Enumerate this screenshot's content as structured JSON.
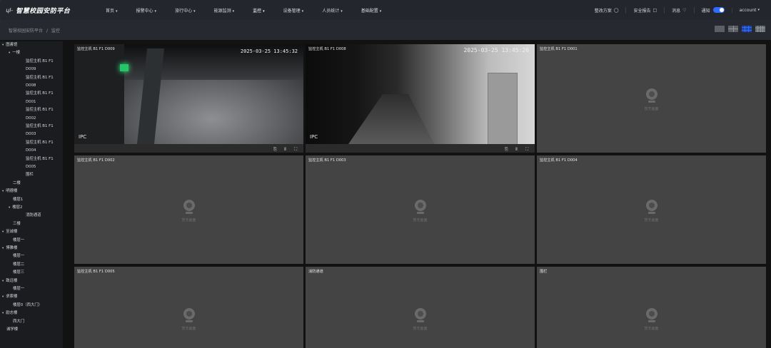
{
  "app": {
    "logo_mark": "ɥl-",
    "title": "智慧校园安防平台"
  },
  "nav": [
    {
      "label": "首页",
      "active": false
    },
    {
      "label": "报警中心",
      "active": false
    },
    {
      "label": "旅行中心",
      "active": false
    },
    {
      "label": "能源监测",
      "active": false
    },
    {
      "label": "监控",
      "active": true
    },
    {
      "label": "设备管理",
      "active": false
    },
    {
      "label": "人员统计",
      "active": false
    },
    {
      "label": "基础配置",
      "active": false
    }
  ],
  "tools": {
    "rectify": "整改方案",
    "security_report": "安全报告",
    "messages": "消息",
    "notify": "通知",
    "account": "account"
  },
  "breadcrumb": [
    "智慧校园安防平台",
    "监控"
  ],
  "tree": [
    {
      "label": "图書馆",
      "level": 0,
      "arrow": "▾"
    },
    {
      "label": "一楼",
      "level": 1,
      "arrow": "▾"
    },
    {
      "label": "监控主机 B1 F1",
      "level": 2
    },
    {
      "label": "D009",
      "level": 2
    },
    {
      "label": "监控主机 B1 F1",
      "level": 2
    },
    {
      "label": "D008",
      "level": 2
    },
    {
      "label": "监控主机 B1 F1",
      "level": 2
    },
    {
      "label": "D001",
      "level": 2
    },
    {
      "label": "监控主机 B1 F1",
      "level": 2
    },
    {
      "label": "D002",
      "level": 2
    },
    {
      "label": "监控主机 B1 F1",
      "level": 2
    },
    {
      "label": "D003",
      "level": 2
    },
    {
      "label": "监控主机 B1 F1",
      "level": 2
    },
    {
      "label": "D004",
      "level": 2
    },
    {
      "label": "监控主机 B1 F1",
      "level": 2
    },
    {
      "label": "D005",
      "level": 2
    },
    {
      "label": "围栏",
      "level": 2
    },
    {
      "label": "二楼",
      "level": 1
    },
    {
      "label": "明德楼",
      "level": 0,
      "arrow": "▾"
    },
    {
      "label": "楼层1",
      "level": 1
    },
    {
      "label": "楼层2",
      "level": 1,
      "arrow": "▾"
    },
    {
      "label": "消防通道",
      "level": 2
    },
    {
      "label": "三楼",
      "level": 1
    },
    {
      "label": "至诚楼",
      "level": 0,
      "arrow": "▾"
    },
    {
      "label": "楼层一",
      "level": 1
    },
    {
      "label": "博雅楼",
      "level": 0,
      "arrow": "▾"
    },
    {
      "label": "楼层一",
      "level": 1
    },
    {
      "label": "楼层二",
      "level": 1
    },
    {
      "label": "楼层三",
      "level": 1
    },
    {
      "label": "致远楼",
      "level": 0,
      "arrow": "▾"
    },
    {
      "label": "楼层一",
      "level": 1
    },
    {
      "label": "求索楼",
      "level": 0,
      "arrow": "▾"
    },
    {
      "label": "楼层0（西大门）",
      "level": 1
    },
    {
      "label": "励志楼",
      "level": 0,
      "arrow": "▾"
    },
    {
      "label": "西大门",
      "level": 1
    },
    {
      "label": "诚学楼",
      "level": 0
    }
  ],
  "cameras": [
    {
      "title": "监控主机 B1 F1 D009",
      "live": true,
      "timestamp": "2025-03-25 13:45:32",
      "overlay": "IPC"
    },
    {
      "title": "监控主机 B1 F1 D008",
      "live": true,
      "timestamp": "2025-03-25 13:45:26",
      "overlay": "IPC"
    },
    {
      "title": "监控主机 B1 F1 D001",
      "live": false
    },
    {
      "title": "监控主机 B1 F1 D002",
      "live": false
    },
    {
      "title": "监控主机 B1 F1 D003",
      "live": false
    },
    {
      "title": "监控主机 B1 F1 D004",
      "live": false
    },
    {
      "title": "监控主机 B1 F1 D005",
      "live": false
    },
    {
      "title": "消防通道",
      "live": false
    },
    {
      "title": "围栏",
      "live": false
    }
  ],
  "placeholder_text": "暂无画面",
  "colors": {
    "accent": "#2f6bff",
    "cell": "#444444",
    "sidebar": "#1a1c20"
  }
}
